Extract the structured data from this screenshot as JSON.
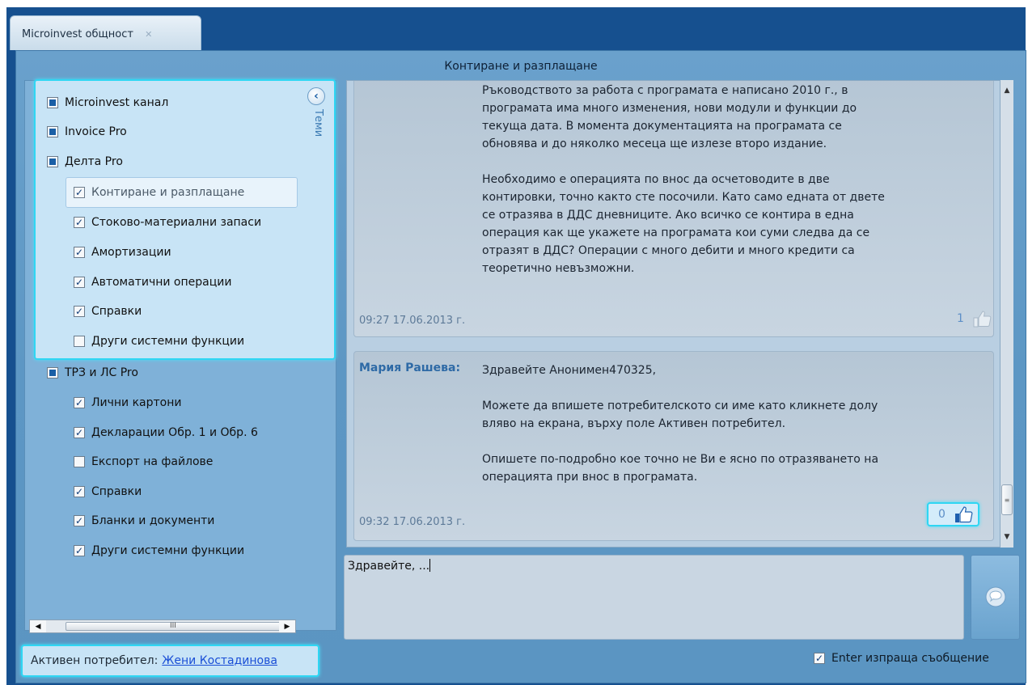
{
  "tab": {
    "title": "Microinvest общност",
    "close_glyph": "✕"
  },
  "header": {
    "title": "Контиране и разплащане"
  },
  "sidebar": {
    "collapse_label": "Теми",
    "items": [
      {
        "label": "Microinvest канал",
        "state": "partial",
        "level": 0
      },
      {
        "label": "Invoice Pro",
        "state": "partial",
        "level": 0
      },
      {
        "label": "Делта Pro",
        "state": "partial",
        "level": 0
      },
      {
        "label": "Контиране и разплащане",
        "state": "checked",
        "level": 1,
        "selected": true
      },
      {
        "label": "Стоково-материални запаси",
        "state": "checked",
        "level": 1
      },
      {
        "label": "Амортизации",
        "state": "checked",
        "level": 1
      },
      {
        "label": "Автоматични операции",
        "state": "checked",
        "level": 1
      },
      {
        "label": "Справки",
        "state": "checked",
        "level": 1
      },
      {
        "label": "Други системни функции",
        "state": "unchecked",
        "level": 1
      },
      {
        "label": "ТРЗ и ЛС Pro",
        "state": "partial",
        "level": 0
      },
      {
        "label": "Лични картони",
        "state": "checked",
        "level": 1
      },
      {
        "label": "Декларации Обр. 1 и Обр. 6",
        "state": "checked",
        "level": 1
      },
      {
        "label": "Експорт на файлове",
        "state": "unchecked",
        "level": 1
      },
      {
        "label": "Справки",
        "state": "checked",
        "level": 1
      },
      {
        "label": "Бланки и документи",
        "state": "checked",
        "level": 1
      },
      {
        "label": "Други системни функции",
        "state": "checked",
        "level": 1
      }
    ],
    "hscroll_grip": "III"
  },
  "user": {
    "label": "Активен потребител:",
    "name": "Жени Костадинова"
  },
  "messages": [
    {
      "author": "",
      "text": "Ръководството за работа с програмата е написано 2010 г., в\nпрограмата има много изменения, нови модули и функции до\nтекуща дата. В момента документацията на програмата се\nобновява и до няколко месеца ще излезе второ издание.\n\nНеобходимо е операцията по внос да осчетоводите в две\nконтировки, точно както сте посочили. Като само едната от двете\nсе отразява в ДДС дневниците. Ако всичко се контира в една\nоперация как ще укажете на програмата кои суми следва да се\nотразят в ДДС? Операции с много дебити и много кредити са\nтеоретично невъзможни.",
      "time": "09:27 17.06.2013 г.",
      "likes": "1"
    },
    {
      "author": "Мария Рашева:",
      "text": "Здравейте Анонимен470325,\n\nМожете да впишете потребителското си име като кликнете долу\nвляво на екрана, върху поле Активен потребител.\n\nОпишете по-подробно кое точно не Ви е ясно по отразяването на\nоперацията при внос в програмата.",
      "time": "09:32 17.06.2013 г.",
      "likes": "0"
    }
  ],
  "compose": {
    "value": "Здравейте, ..."
  },
  "enter_option": {
    "label": "Enter изпраща съобщение",
    "checked": true
  },
  "colors": {
    "frame": "#16508f",
    "highlight": "#2fd6f3",
    "link": "#1a4ed6",
    "author": "#2e6aa6"
  }
}
